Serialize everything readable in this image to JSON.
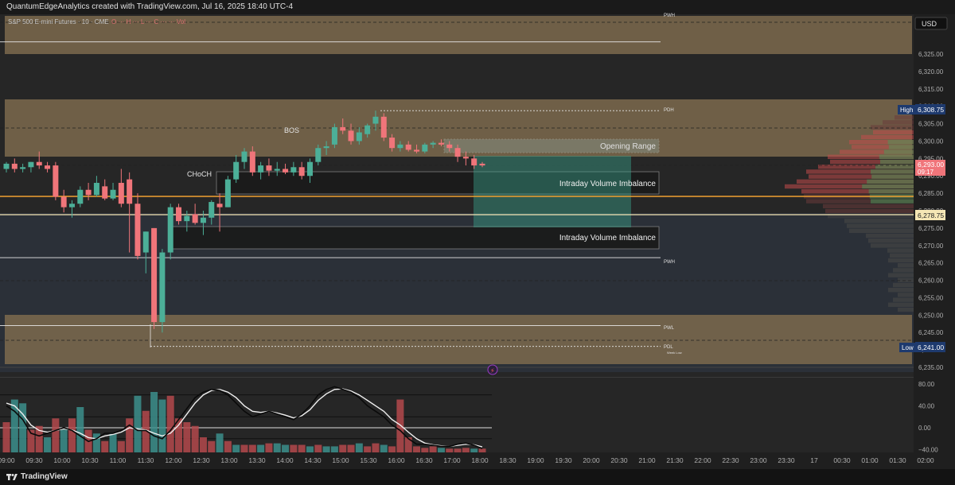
{
  "header": {
    "attribution": "QuantumEdgeAnalytics created with TradingView.com, Jul 16, 2025 18:40 UTC-4",
    "legend_symbol": "S&P 500 E-mini Futures · 10 · CME",
    "legend_rest": "O ··· H ··· L ··· C ··· ··· Vol"
  },
  "footer": {
    "brand": "TradingView"
  },
  "price_axis": {
    "currency": "USD",
    "ticks": [
      "6,325.00",
      "6,320.00",
      "6,315.00",
      "6,310.00",
      "6,305.00",
      "6,300.00",
      "6,295.00",
      "6,290.00",
      "6,285.00",
      "6,280.00",
      "6,275.00",
      "6,270.00",
      "6,265.00",
      "6,260.00",
      "6,255.00",
      "6,250.00",
      "6,245.00",
      "6,240.00",
      "6,235.00"
    ],
    "high_label": "High",
    "high_value": "6,308.75",
    "low_label": "Low",
    "low_value": "6,241.00",
    "last_value": "6,293.00",
    "countdown": "09:17",
    "level_value": "6,278.75"
  },
  "osc_axis": {
    "ticks": [
      "80.00",
      "40.00",
      "0.00",
      "−40.00"
    ]
  },
  "time_axis": {
    "ticks": [
      "09:00",
      "09:30",
      "10:00",
      "10:30",
      "11:00",
      "11:30",
      "12:00",
      "12:30",
      "13:00",
      "13:30",
      "14:00",
      "14:30",
      "15:00",
      "15:30",
      "16:00",
      "16:30",
      "17:00",
      "18:00",
      "18:30",
      "19:00",
      "19:30",
      "20:00",
      "20:30",
      "21:00",
      "21:30",
      "22:00",
      "22:30",
      "23:00",
      "23:30",
      "17",
      "00:30",
      "01:00",
      "01:30",
      "02:00"
    ]
  },
  "annotations": {
    "pwh_top": "PWH",
    "pdh": "PDH",
    "pwh_mid": "PWH",
    "pwl": "PWL",
    "pdl": "PDL",
    "week_low": "Week Low",
    "bos": "BOS",
    "choch": "CHoCH",
    "opening_range": "Opening Range",
    "ivi_1": "Intraday Volume Imbalance",
    "ivi_2": "Intraday Volume Imbalance"
  },
  "colors": {
    "up": "#4caf98",
    "down": "#f0757a",
    "zone": "#7d6a4e",
    "accent_orange": "#f0a030"
  },
  "chart_data": {
    "type": "candlestick",
    "symbol": "S&P 500 E-mini Futures",
    "interval": "10",
    "y_range": [
      6233,
      6330
    ],
    "candles": [
      {
        "t": "09:00",
        "o": 6292.0,
        "h": 6294.0,
        "l": 6291.0,
        "c": 6293.5
      },
      {
        "t": "09:10",
        "o": 6293.5,
        "h": 6295.0,
        "l": 6291.0,
        "c": 6292.0
      },
      {
        "t": "09:20",
        "o": 6292.0,
        "h": 6293.5,
        "l": 6291.0,
        "c": 6292.5
      },
      {
        "t": "09:30",
        "o": 6292.5,
        "h": 6294.0,
        "l": 6291.0,
        "c": 6294.0
      },
      {
        "t": "09:40",
        "o": 6294.0,
        "h": 6297.0,
        "l": 6292.0,
        "c": 6293.0
      },
      {
        "t": "09:50",
        "o": 6293.0,
        "h": 6294.0,
        "l": 6291.0,
        "c": 6292.0
      },
      {
        "t": "10:00",
        "o": 6293.0,
        "h": 6294.0,
        "l": 6283.0,
        "c": 6284.0
      },
      {
        "t": "10:10",
        "o": 6284.0,
        "h": 6286.0,
        "l": 6279.5,
        "c": 6281.0
      },
      {
        "t": "10:20",
        "o": 6281.0,
        "h": 6283.0,
        "l": 6278.0,
        "c": 6282.0
      },
      {
        "t": "10:30",
        "o": 6282.0,
        "h": 6287.0,
        "l": 6281.0,
        "c": 6286.0
      },
      {
        "t": "10:40",
        "o": 6286.0,
        "h": 6288.0,
        "l": 6283.0,
        "c": 6284.5
      },
      {
        "t": "10:50",
        "o": 6284.5,
        "h": 6290.0,
        "l": 6284.0,
        "c": 6288.0
      },
      {
        "t": "11:00",
        "o": 6287.0,
        "h": 6289.0,
        "l": 6283.0,
        "c": 6283.5
      },
      {
        "t": "11:10",
        "o": 6283.5,
        "h": 6288.0,
        "l": 6283.0,
        "c": 6286.0
      },
      {
        "t": "11:20",
        "o": 6288.0,
        "h": 6292.0,
        "l": 6281.0,
        "c": 6282.0
      },
      {
        "t": "11:30",
        "o": 6289.0,
        "h": 6291.0,
        "l": 6268.0,
        "c": 6282.0
      },
      {
        "t": "11:40",
        "o": 6282.0,
        "h": 6285.0,
        "l": 6266.0,
        "c": 6267.0
      },
      {
        "t": "11:50",
        "o": 6268.0,
        "h": 6274.0,
        "l": 6262.0,
        "c": 6274.0
      },
      {
        "t": "12:00",
        "o": 6275.0,
        "h": 6275.0,
        "l": 6246.0,
        "c": 6248.0
      },
      {
        "t": "12:10",
        "o": 6248.0,
        "h": 6269.0,
        "l": 6245.0,
        "c": 6268.0
      },
      {
        "t": "12:20",
        "o": 6268.0,
        "h": 6282.0,
        "l": 6266.0,
        "c": 6281.0
      },
      {
        "t": "12:30",
        "o": 6281.0,
        "h": 6282.0,
        "l": 6276.0,
        "c": 6277.0
      },
      {
        "t": "12:40",
        "o": 6277.0,
        "h": 6280.0,
        "l": 6274.0,
        "c": 6278.5
      },
      {
        "t": "12:50",
        "o": 6279.0,
        "h": 6282.0,
        "l": 6276.0,
        "c": 6276.5
      },
      {
        "t": "13:00",
        "o": 6276.5,
        "h": 6280.0,
        "l": 6273.0,
        "c": 6278.0
      },
      {
        "t": "13:10",
        "o": 6278.0,
        "h": 6283.0,
        "l": 6276.0,
        "c": 6282.5
      },
      {
        "t": "13:20",
        "o": 6282.0,
        "h": 6285.0,
        "l": 6274.0,
        "c": 6281.0
      },
      {
        "t": "13:30",
        "o": 6281.0,
        "h": 6290.0,
        "l": 6281.0,
        "c": 6289.0
      },
      {
        "t": "13:40",
        "o": 6289.0,
        "h": 6296.0,
        "l": 6288.0,
        "c": 6294.0
      },
      {
        "t": "13:50",
        "o": 6294.0,
        "h": 6298.0,
        "l": 6292.0,
        "c": 6297.0
      },
      {
        "t": "14:00",
        "o": 6297.0,
        "h": 6298.5,
        "l": 6290.0,
        "c": 6291.0
      },
      {
        "t": "14:10",
        "o": 6291.0,
        "h": 6294.0,
        "l": 6289.0,
        "c": 6293.0
      },
      {
        "t": "14:20",
        "o": 6293.0,
        "h": 6295.0,
        "l": 6290.0,
        "c": 6291.5
      },
      {
        "t": "14:30",
        "o": 6291.5,
        "h": 6294.0,
        "l": 6290.0,
        "c": 6292.0
      },
      {
        "t": "14:40",
        "o": 6292.0,
        "h": 6293.5,
        "l": 6290.5,
        "c": 6291.0
      },
      {
        "t": "14:50",
        "o": 6291.0,
        "h": 6294.0,
        "l": 6290.0,
        "c": 6292.5
      },
      {
        "t": "15:00",
        "o": 6292.5,
        "h": 6294.0,
        "l": 6289.0,
        "c": 6290.0
      },
      {
        "t": "15:10",
        "o": 6290.0,
        "h": 6295.0,
        "l": 6288.0,
        "c": 6294.0
      },
      {
        "t": "15:20",
        "o": 6294.0,
        "h": 6299.0,
        "l": 6293.0,
        "c": 6298.0
      },
      {
        "t": "15:30",
        "o": 6298.0,
        "h": 6300.0,
        "l": 6296.0,
        "c": 6298.5
      },
      {
        "t": "15:40",
        "o": 6299.0,
        "h": 6305.0,
        "l": 6298.0,
        "c": 6304.0
      },
      {
        "t": "15:50",
        "o": 6304.0,
        "h": 6306.5,
        "l": 6302.0,
        "c": 6303.0
      },
      {
        "t": "16:00",
        "o": 6303.0,
        "h": 6305.0,
        "l": 6299.0,
        "c": 6300.0
      },
      {
        "t": "16:10",
        "o": 6300.0,
        "h": 6304.0,
        "l": 6299.0,
        "c": 6302.5
      },
      {
        "t": "16:20",
        "o": 6302.0,
        "h": 6305.0,
        "l": 6301.0,
        "c": 6304.5
      },
      {
        "t": "16:30",
        "o": 6305.0,
        "h": 6308.75,
        "l": 6303.0,
        "c": 6307.0
      },
      {
        "t": "16:40",
        "o": 6307.0,
        "h": 6308.0,
        "l": 6300.0,
        "c": 6301.0
      },
      {
        "t": "16:50",
        "o": 6301.0,
        "h": 6302.0,
        "l": 6297.0,
        "c": 6298.0
      },
      {
        "t": "17:00",
        "o": 6298.0,
        "h": 6300.0,
        "l": 6297.0,
        "c": 6299.0
      },
      {
        "t": "17:10",
        "o": 6299.0,
        "h": 6300.0,
        "l": 6297.0,
        "c": 6297.5
      },
      {
        "t": "17:20",
        "o": 6297.5,
        "h": 6299.0,
        "l": 6296.5,
        "c": 6297.0
      },
      {
        "t": "17:30",
        "o": 6297.0,
        "h": 6299.5,
        "l": 6296.5,
        "c": 6299.0
      },
      {
        "t": "17:40",
        "o": 6299.0,
        "h": 6300.0,
        "l": 6298.0,
        "c": 6299.5
      },
      {
        "t": "17:50",
        "o": 6299.5,
        "h": 6300.5,
        "l": 6298.5,
        "c": 6299.0
      },
      {
        "t": "18:00",
        "o": 6299.0,
        "h": 6300.0,
        "l": 6297.0,
        "c": 6298.0
      },
      {
        "t": "18:10",
        "o": 6298.0,
        "h": 6299.0,
        "l": 6294.0,
        "c": 6295.5
      },
      {
        "t": "18:20",
        "o": 6295.5,
        "h": 6297.0,
        "l": 6293.0,
        "c": 6295.0
      },
      {
        "t": "18:30",
        "o": 6295.0,
        "h": 6296.0,
        "l": 6292.0,
        "c": 6293.0
      },
      {
        "t": "18:40",
        "o": 6293.5,
        "h": 6294.0,
        "l": 6292.5,
        "c": 6293.0
      }
    ],
    "levels": [
      {
        "label": "PWH",
        "price": 6328.5
      },
      {
        "label": "PDH",
        "price": 6308.75
      },
      {
        "label": "PWH",
        "price": 6266.5
      },
      {
        "label": "PWL",
        "price": 6247.0
      },
      {
        "label": "PDL",
        "price": 6241.0
      }
    ],
    "oscillator": {
      "y_range": [
        -45,
        90
      ],
      "levels": [
        60,
        20,
        0,
        -20
      ],
      "volume": [
        40,
        70,
        65,
        30,
        35,
        20,
        45,
        30,
        45,
        60,
        30,
        25,
        15,
        25,
        15,
        45,
        75,
        55,
        80,
        70,
        75,
        45,
        40,
        35,
        20,
        15,
        25,
        15,
        10,
        10,
        10,
        10,
        12,
        12,
        10,
        10,
        10,
        8,
        10,
        8,
        8,
        10,
        10,
        12,
        8,
        12,
        10,
        8,
        70,
        20,
        8,
        6,
        8,
        6,
        5,
        5,
        6,
        5,
        5
      ],
      "vol_up": [
        false,
        true,
        true,
        false,
        false,
        true,
        false,
        true,
        false,
        true,
        false,
        true,
        false,
        true,
        false,
        false,
        true,
        false,
        true,
        true,
        false,
        false,
        false,
        false,
        false,
        false,
        true,
        false,
        true,
        false,
        false,
        true,
        false,
        true,
        true,
        false,
        false,
        true,
        false,
        true,
        true,
        false,
        false,
        true,
        false,
        false,
        true,
        false,
        false,
        false,
        false,
        false,
        false,
        true,
        false,
        false,
        false,
        true,
        false
      ],
      "line_black": [
        40,
        30,
        15,
        -10,
        -15,
        -10,
        -5,
        0,
        -5,
        -15,
        -25,
        -20,
        -10,
        -10,
        -5,
        5,
        -5,
        -5,
        -15,
        -20,
        -5,
        15,
        35,
        55,
        65,
        70,
        68,
        60,
        45,
        30,
        20,
        25,
        30,
        25,
        20,
        15,
        25,
        40,
        60,
        70,
        75,
        70,
        65,
        55,
        40,
        30,
        20,
        5,
        -5,
        -20,
        -30,
        -30,
        -32,
        -34,
        -34,
        -30,
        -28,
        -32,
        -38
      ],
      "line_white": [
        45,
        40,
        25,
        5,
        -5,
        -8,
        -5,
        -2,
        -4,
        -10,
        -18,
        -20,
        -15,
        -12,
        -8,
        0,
        -2,
        -4,
        -10,
        -15,
        -10,
        5,
        25,
        45,
        60,
        68,
        70,
        65,
        55,
        40,
        30,
        28,
        30,
        27,
        23,
        18,
        22,
        33,
        50,
        62,
        70,
        71,
        67,
        60,
        50,
        40,
        30,
        15,
        5,
        -8,
        -20,
        -28,
        -31,
        -33,
        -34,
        -32,
        -30,
        -31,
        -35
      ]
    }
  }
}
